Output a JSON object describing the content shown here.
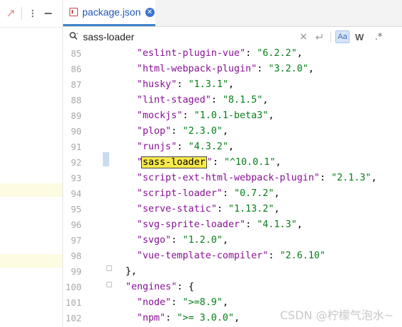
{
  "tab": {
    "title": "package.json"
  },
  "search": {
    "value": "sass-loader",
    "case_label": "Aa",
    "word_label": "W",
    "regex_label": ".*"
  },
  "lines": [
    {
      "num": "85",
      "key": "eslint-plugin-vue",
      "value": "6.2.2"
    },
    {
      "num": "86",
      "key": "html-webpack-plugin",
      "value": "3.2.0"
    },
    {
      "num": "87",
      "key": "husky",
      "value": "1.3.1"
    },
    {
      "num": "88",
      "key": "lint-staged",
      "value": "8.1.5"
    },
    {
      "num": "89",
      "key": "mockjs",
      "value": "1.0.1-beta3"
    },
    {
      "num": "90",
      "key": "plop",
      "value": "2.3.0"
    },
    {
      "num": "91",
      "key": "runjs",
      "value": "4.3.2"
    },
    {
      "num": "92",
      "key": "sass-loader",
      "value": "^10.0.1",
      "match": true
    },
    {
      "num": "93",
      "key": "script-ext-html-webpack-plugin",
      "value": "2.1.3"
    },
    {
      "num": "94",
      "key": "script-loader",
      "value": "0.7.2"
    },
    {
      "num": "95",
      "key": "serve-static",
      "value": "1.13.2"
    },
    {
      "num": "96",
      "key": "svg-sprite-loader",
      "value": "4.1.3"
    },
    {
      "num": "97",
      "key": "svgo",
      "value": "1.2.0"
    },
    {
      "num": "98",
      "key": "vue-template-compiler",
      "value": "2.6.10",
      "last": true
    },
    {
      "num": "99",
      "text": "},"
    },
    {
      "num": "100",
      "key": "engines",
      "brace": "{"
    },
    {
      "num": "101",
      "key": "node",
      "value": ">=8.9"
    },
    {
      "num": "102",
      "key": "npm",
      "value": ">= 3.0.0"
    }
  ],
  "watermark": "CSDN @柠檬气泡水~",
  "colors": {
    "key": "#871094",
    "string": "#067d17",
    "match_bg": "#f7e94c",
    "tab_accent": "#4083c9"
  }
}
